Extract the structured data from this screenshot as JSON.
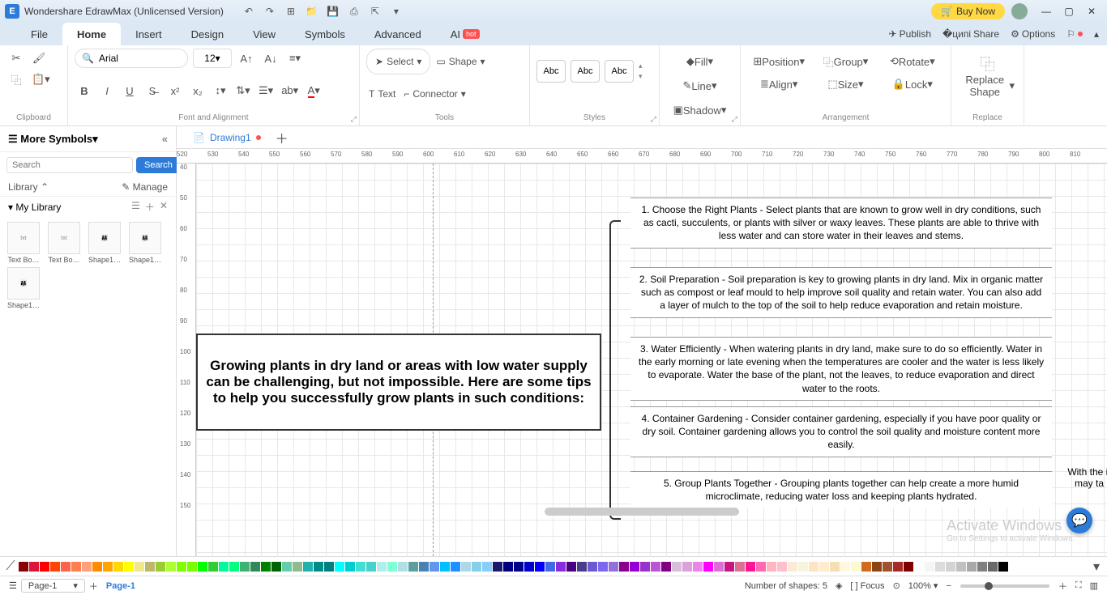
{
  "titlebar": {
    "app_title": "Wondershare EdrawMax (Unlicensed Version)",
    "buy_now": "Buy Now"
  },
  "menus": {
    "file": "File",
    "home": "Home",
    "insert": "Insert",
    "design": "Design",
    "view": "View",
    "symbols": "Symbols",
    "advanced": "Advanced",
    "ai": "AI",
    "hot": "hot",
    "publish": "Publish",
    "share": "Share",
    "options": "Options"
  },
  "ribbon": {
    "clipboard": "Clipboard",
    "font_name": "Arial",
    "font_size": "12",
    "font_align": "Font and Alignment",
    "select": "Select",
    "shape": "Shape",
    "text": "Text",
    "connector": "Connector",
    "tools": "Tools",
    "abc": "Abc",
    "styles": "Styles",
    "fill": "Fill",
    "line": "Line",
    "shadow": "Shadow",
    "position": "Position",
    "align": "Align",
    "group": "Group",
    "size": "Size",
    "rotate": "Rotate",
    "lock": "Lock",
    "arrangement": "Arrangement",
    "replace_shape": "Replace Shape",
    "replace": "Replace"
  },
  "sidepanel": {
    "more_symbols": "More Symbols",
    "search_placeholder": "Search",
    "search_btn": "Search",
    "library": "Library",
    "manage": "Manage",
    "my_library": "My Library",
    "thumbs": [
      "Text Bo…",
      "Text Bo…",
      "Shape1…",
      "Shape1…",
      "Shape1…"
    ]
  },
  "doc": {
    "tab": "Drawing1",
    "page_tab": "Page-1"
  },
  "ruler_h": [
    "520",
    "530",
    "540",
    "550",
    "560",
    "570",
    "580",
    "590",
    "600",
    "610",
    "620",
    "630",
    "640",
    "650",
    "660",
    "670",
    "680",
    "690",
    "700",
    "710",
    "720",
    "730",
    "740",
    "750",
    "760",
    "770",
    "780",
    "790",
    "800",
    "810"
  ],
  "ruler_v": [
    "40",
    "50",
    "60",
    "70",
    "80",
    "90",
    "100",
    "110",
    "120",
    "130",
    "140",
    "150"
  ],
  "content": {
    "main": "Growing plants in dry land or areas with low water supply can be challenging, but not impossible. Here are some tips to help you successfully grow plants in such conditions:",
    "tips": [
      "1. Choose the Right Plants - Select plants that are known to grow well in dry conditions, such as cacti, succulents, or plants with silver or waxy leaves. These plants are able to thrive with less water and can store water in their leaves and stems.",
      "2. Soil Preparation - Soil preparation is key to growing plants in dry land. Mix in organic matter such as compost or leaf mould to help improve soil quality and retain water. You can also add a layer of mulch to the top of the soil to help reduce evaporation and retain moisture.",
      "3. Water Efficiently - When watering plants in dry land, make sure to do so efficiently. Water in the early morning or late evening when the temperatures are cooler and the water is less likely to evaporate. Water the base of the plant, not the leaves, to reduce evaporation and direct water to the roots.",
      "4. Container Gardening - Consider container gardening, especially if you have poor quality or dry soil. Container gardening allows you to control the soil quality and moisture content more easily.",
      "5. Group Plants Together - Grouping plants together can help create a more humid microclimate, reducing water loss and keeping plants hydrated."
    ],
    "side": "With the it may ta",
    "activate": "Activate Windows",
    "activate_sub": "Go to Settings to activate Windows."
  },
  "status": {
    "page_selector": "Page-1",
    "shapes": "Number of shapes: 5",
    "focus": "Focus",
    "zoom": "100%"
  },
  "colors": [
    "#8b0000",
    "#dc143c",
    "#ff0000",
    "#ff4500",
    "#ff6347",
    "#ff7f50",
    "#ffa07a",
    "#ff8c00",
    "#ffa500",
    "#ffd700",
    "#ffff00",
    "#f0e68c",
    "#bdb76b",
    "#9acd32",
    "#adff2f",
    "#7fff00",
    "#7cfc00",
    "#00ff00",
    "#32cd32",
    "#00fa9a",
    "#00ff7f",
    "#3cb371",
    "#2e8b57",
    "#008000",
    "#006400",
    "#66cdaa",
    "#8fbc8f",
    "#20b2aa",
    "#008b8b",
    "#008080",
    "#00ffff",
    "#00ced1",
    "#40e0d0",
    "#48d1cc",
    "#afeeee",
    "#7fffd4",
    "#b0e0e6",
    "#5f9ea0",
    "#4682b4",
    "#6495ed",
    "#00bfff",
    "#1e90ff",
    "#add8e6",
    "#87ceeb",
    "#87cefa",
    "#191970",
    "#000080",
    "#00008b",
    "#0000cd",
    "#0000ff",
    "#4169e1",
    "#8a2be2",
    "#4b0082",
    "#483d8b",
    "#6a5acd",
    "#7b68ee",
    "#9370db",
    "#8b008b",
    "#9400d3",
    "#9932cc",
    "#ba55d3",
    "#800080",
    "#d8bfd8",
    "#dda0dd",
    "#ee82ee",
    "#ff00ff",
    "#da70d6",
    "#c71585",
    "#db7093",
    "#ff1493",
    "#ff69b4",
    "#ffb6c1",
    "#ffc0cb",
    "#faebd7",
    "#f5f5dc",
    "#ffe4c4",
    "#ffebcd",
    "#f5deb3",
    "#fff8dc",
    "#fffacd",
    "#d2691e",
    "#8b4513",
    "#a0522d",
    "#a52a2a",
    "#800000",
    "#ffffff",
    "#f5f5f5",
    "#dcdcdc",
    "#d3d3d3",
    "#c0c0c0",
    "#a9a9a9",
    "#808080",
    "#696969",
    "#000000"
  ]
}
